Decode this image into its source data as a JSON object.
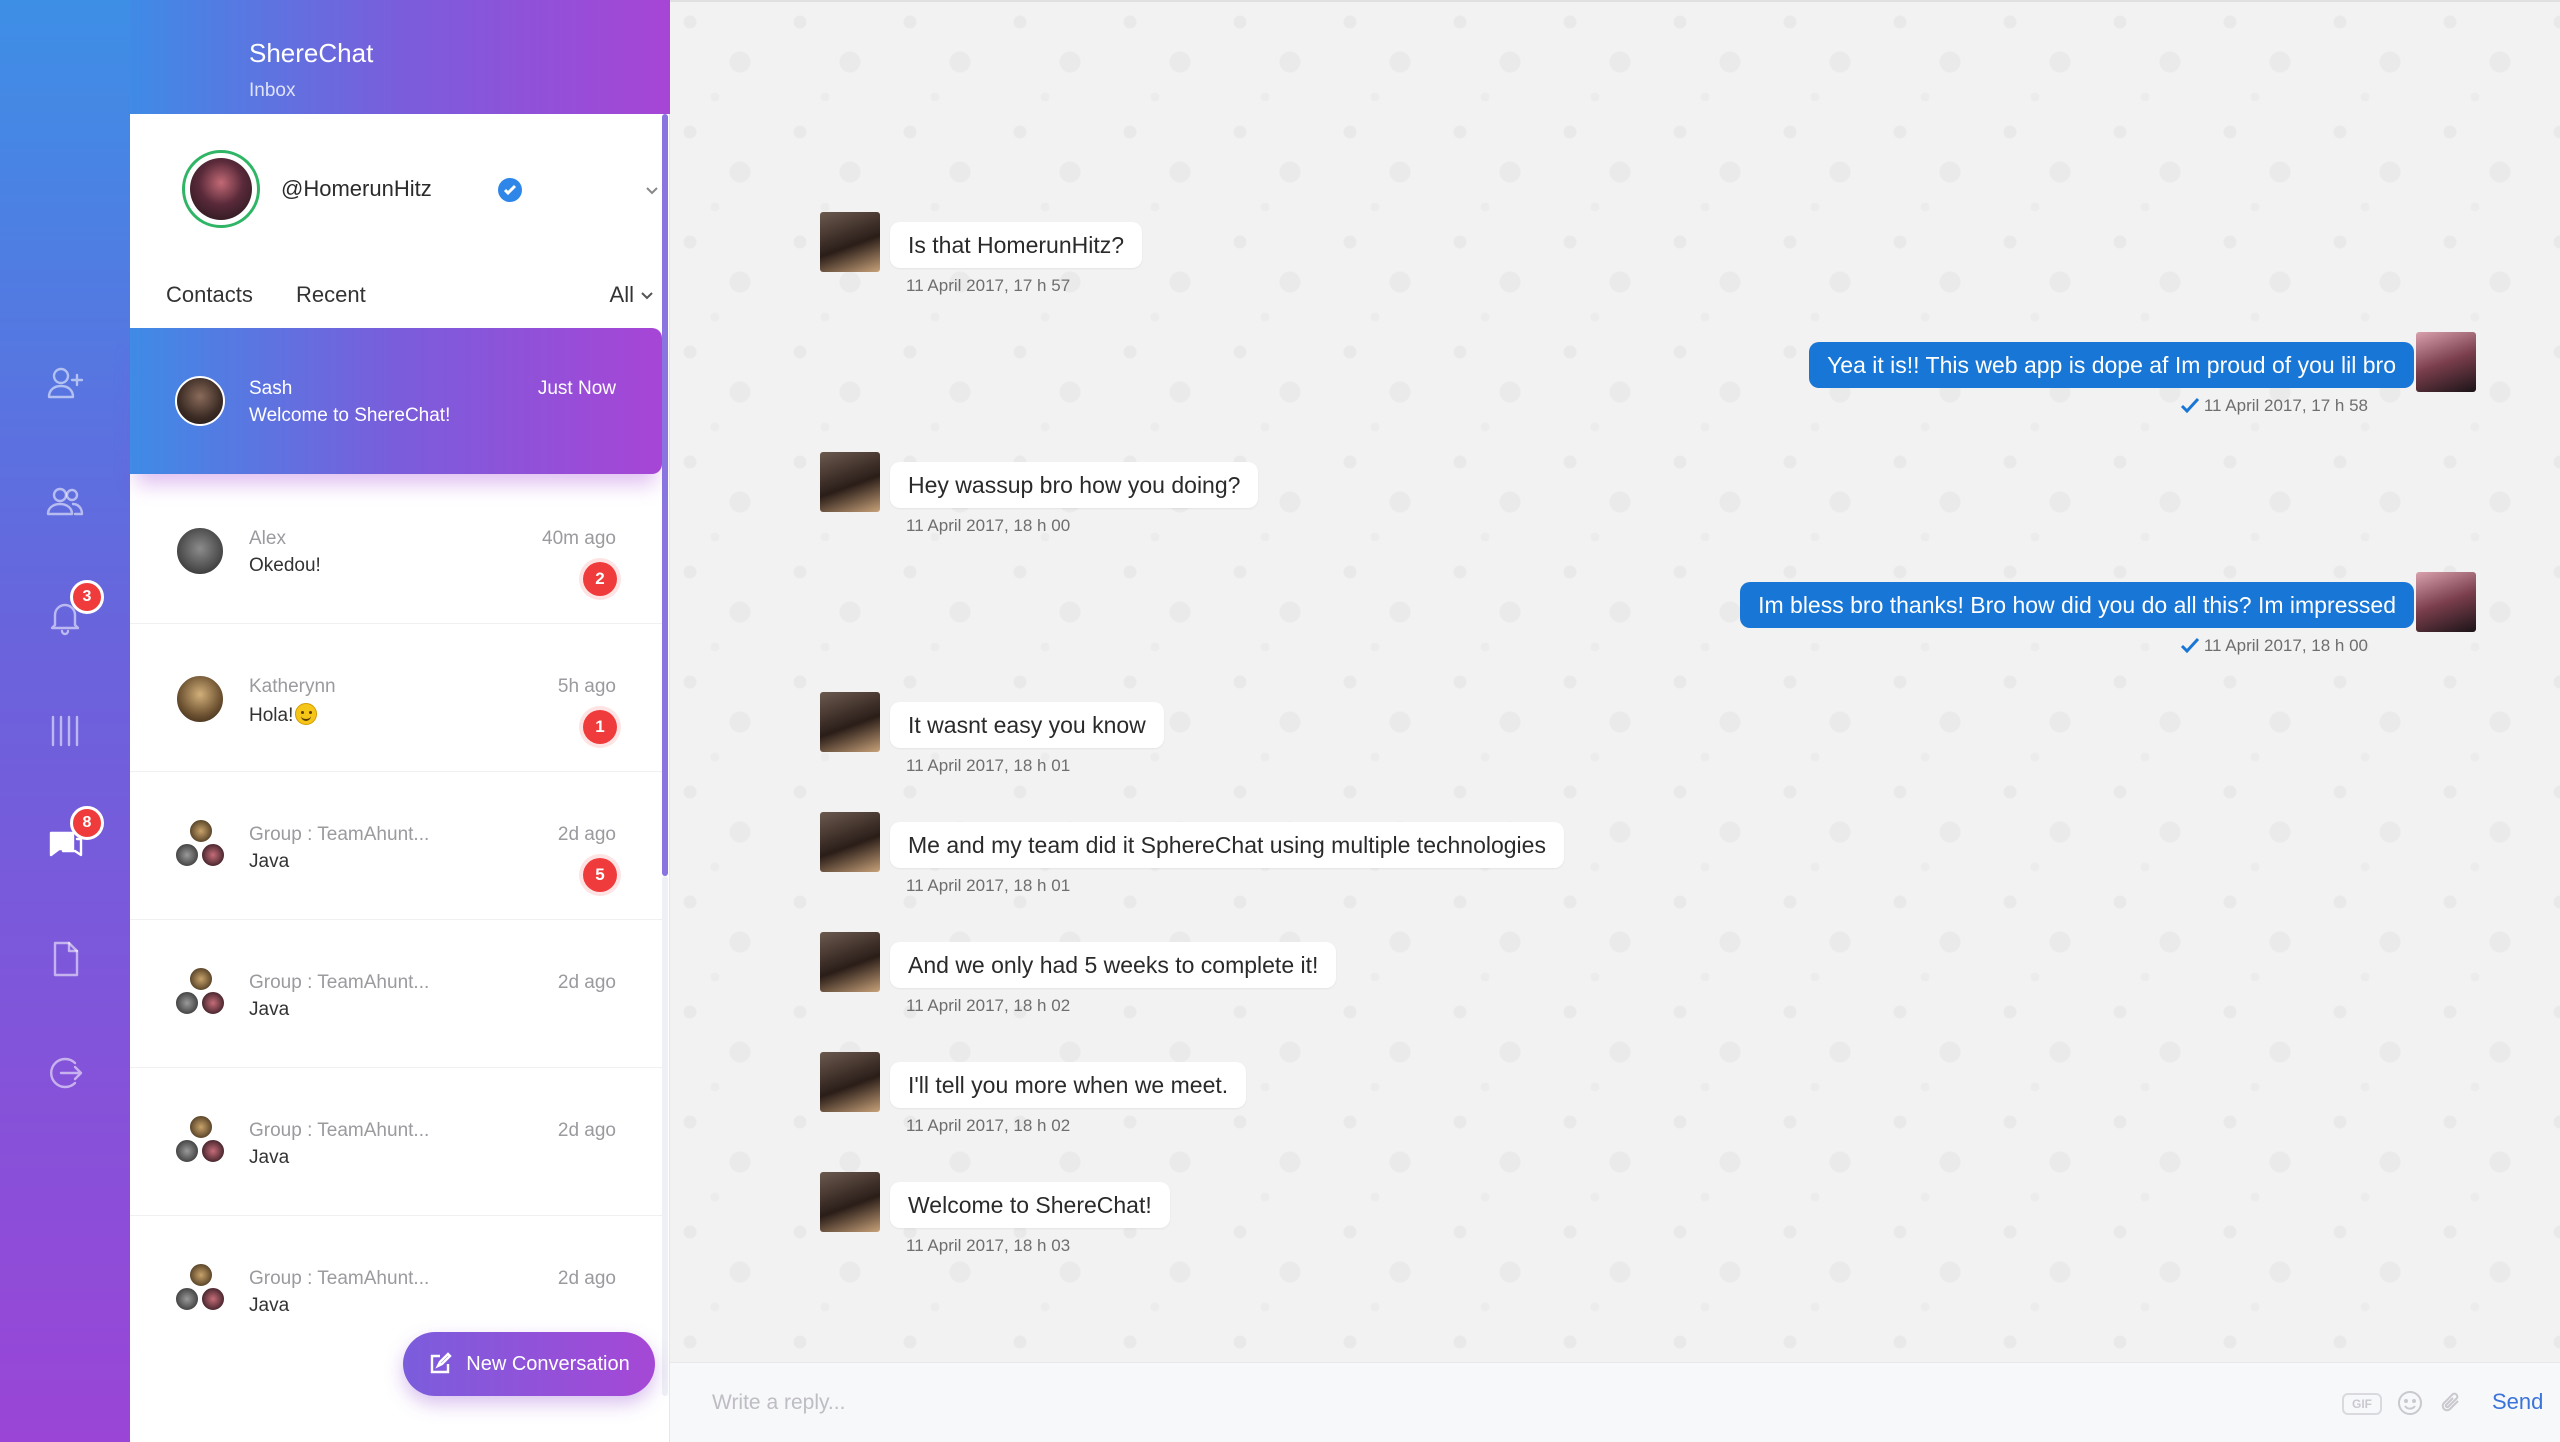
{
  "app": {
    "title": "ShereChat",
    "subtitle": "Inbox"
  },
  "rail": {
    "items": [
      {
        "icon": "add-user-icon"
      },
      {
        "icon": "users-icon"
      },
      {
        "icon": "bell-icon",
        "badge": "3"
      },
      {
        "icon": "bars-icon"
      },
      {
        "icon": "chat-icon",
        "badge": "8",
        "active": true
      },
      {
        "icon": "document-icon"
      },
      {
        "icon": "logout-icon"
      }
    ]
  },
  "profile": {
    "username": "@HomerunHitz",
    "verified": true
  },
  "filters": {
    "contacts": "Contacts",
    "recent": "Recent",
    "all": "All"
  },
  "conversations": [
    {
      "name": "Sash",
      "message": "Welcome to ShereChat!",
      "time": "Just Now",
      "active": true
    },
    {
      "name": "Alex",
      "message": "Okedou!",
      "time": "40m ago",
      "badge": "2"
    },
    {
      "name": "Katherynn",
      "message": "Hola!",
      "time": "5h ago",
      "badge": "1"
    },
    {
      "name": "Group : TeamAhunt...",
      "message": "Java",
      "time": "2d ago",
      "badge": "5"
    },
    {
      "name": "Group : TeamAhunt...",
      "message": "Java",
      "time": "2d ago"
    },
    {
      "name": "Group : TeamAhunt...",
      "message": "Java",
      "time": "2d ago"
    },
    {
      "name": "Group : TeamAhunt...",
      "message": "Java",
      "time": "2d ago"
    }
  ],
  "new_conversation": "New Conversation",
  "messages": [
    {
      "dir": "in",
      "text": "Is that HomerunHitz?",
      "time": "11 April 2017, 17 h 57"
    },
    {
      "dir": "out",
      "text": "Yea it is!! This web app is dope af Im proud of you lil bro",
      "time": "11 April 2017, 17 h 58"
    },
    {
      "dir": "in",
      "text": "Hey wassup bro how you doing?",
      "time": "11 April 2017, 18 h 00"
    },
    {
      "dir": "out",
      "text": "Im bless bro thanks! Bro how did you do all this? Im impressed",
      "time": "11 April 2017, 18 h 00"
    },
    {
      "dir": "in",
      "text": "It wasnt easy you know",
      "time": "11 April 2017, 18 h 01"
    },
    {
      "dir": "in",
      "text": "Me and my team did it SphereChat using multiple technologies",
      "time": "11 April 2017, 18 h 01"
    },
    {
      "dir": "in",
      "text": "And we only had 5 weeks to complete it!",
      "time": "11 April 2017, 18 h 02"
    },
    {
      "dir": "in",
      "text": "I'll tell you more when we meet.",
      "time": "11 April 2017, 18 h 02"
    },
    {
      "dir": "in",
      "text": "Welcome to ShereChat!",
      "time": "11 April 2017, 18 h 03"
    }
  ],
  "reply": {
    "placeholder": "Write a reply...",
    "gif": "GIF",
    "send": "Send"
  },
  "colors": {
    "accent_blue": "#1876d6",
    "accent_purple": "#a745d6",
    "badge_red": "#ef3b3b",
    "online_green": "#2fb565"
  }
}
